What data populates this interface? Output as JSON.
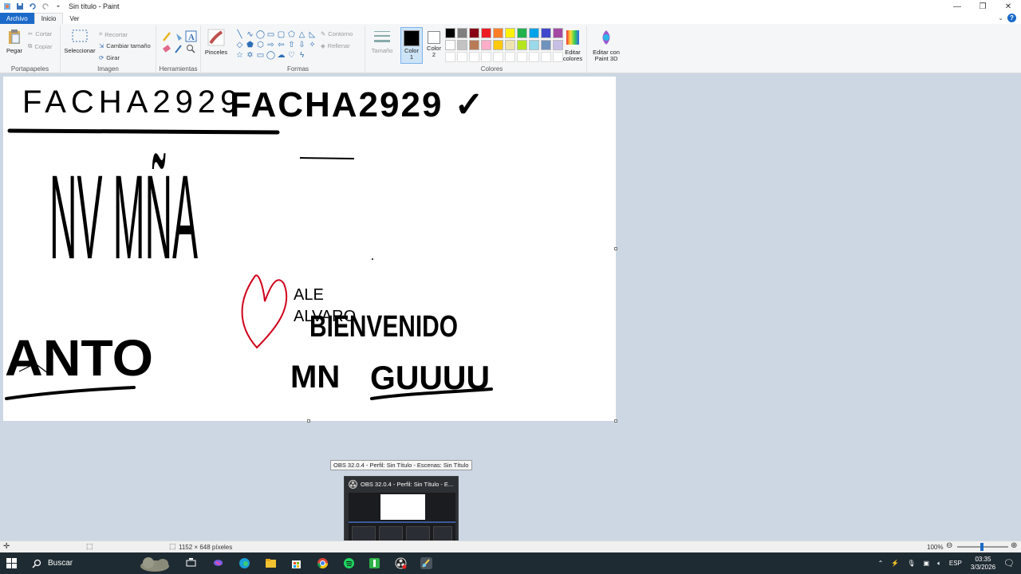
{
  "window": {
    "title": "Sin título - Paint",
    "controls": {
      "minimize": "—",
      "restore": "❐",
      "close": "✕"
    }
  },
  "tabs": [
    {
      "label": "Archivo"
    },
    {
      "label": "Inicio"
    },
    {
      "label": "Ver"
    }
  ],
  "ribbon": {
    "portapapeles": {
      "paste": "Pegar",
      "cut": "Cortar",
      "copy": "Copiar",
      "group": "Portapapeles"
    },
    "imagen": {
      "select": "Seleccionar",
      "crop": "Recortar",
      "resize": "Cambiar tamaño",
      "rotate": "Girar",
      "group": "Imagen"
    },
    "herramientas": {
      "group": "Herramientas"
    },
    "pinceles": {
      "label": "Pinceles"
    },
    "formas": {
      "outline": "Contorno",
      "fill": "Rellenar",
      "group": "Formas"
    },
    "tamano": {
      "label": "Tamaño"
    },
    "colores": {
      "color1": "Color 1",
      "color2": "Color 2",
      "edit": "Editar colores",
      "paint3d": "Editar con Paint 3D",
      "group": "Colores",
      "color1_value": "#000000",
      "color2_value": "#ffffff",
      "palette": [
        "#000000",
        "#7f7f7f",
        "#880015",
        "#ed1c24",
        "#ff7f27",
        "#fff200",
        "#22b14c",
        "#00a2e8",
        "#3f48cc",
        "#a349a4",
        "#ffffff",
        "#c3c3c3",
        "#b97a57",
        "#ffaec9",
        "#ffc90e",
        "#efe4b0",
        "#b5e61d",
        "#99d9ea",
        "#7092be",
        "#c8bfe7",
        "#ffffff",
        "#ffffff",
        "#ffffff",
        "#ffffff",
        "#ffffff",
        "#ffffff",
        "#ffffff",
        "#ffffff",
        "#ffffff",
        "#ffffff"
      ]
    }
  },
  "canvas": {
    "text_top_left": "FACHA2929",
    "text_top_right": "FACHA2929 ✓",
    "letters_middle": "NV MÑA",
    "small_text_1": "ALE",
    "small_text_2": "ALVARO",
    "text_bienvenido": "BIENVENIDO",
    "text_mn": "MN",
    "text_guuuu": "GUUUU",
    "text_anto": "ANTO",
    "heart_color": "#d0021b"
  },
  "status": {
    "dimensions": "1152 × 648 píxeles",
    "zoom": "100%"
  },
  "taskbar": {
    "search_placeholder": "Buscar",
    "time": "03:35",
    "date": "3/3/2026",
    "language": "ESP"
  },
  "obs": {
    "tooltip": "OBS 32.0.4 - Perfil: Sin Título - Escenas: Sin Título",
    "thumb_title": "OBS 32.0.4 - Perfil: Sin Título - E..."
  }
}
